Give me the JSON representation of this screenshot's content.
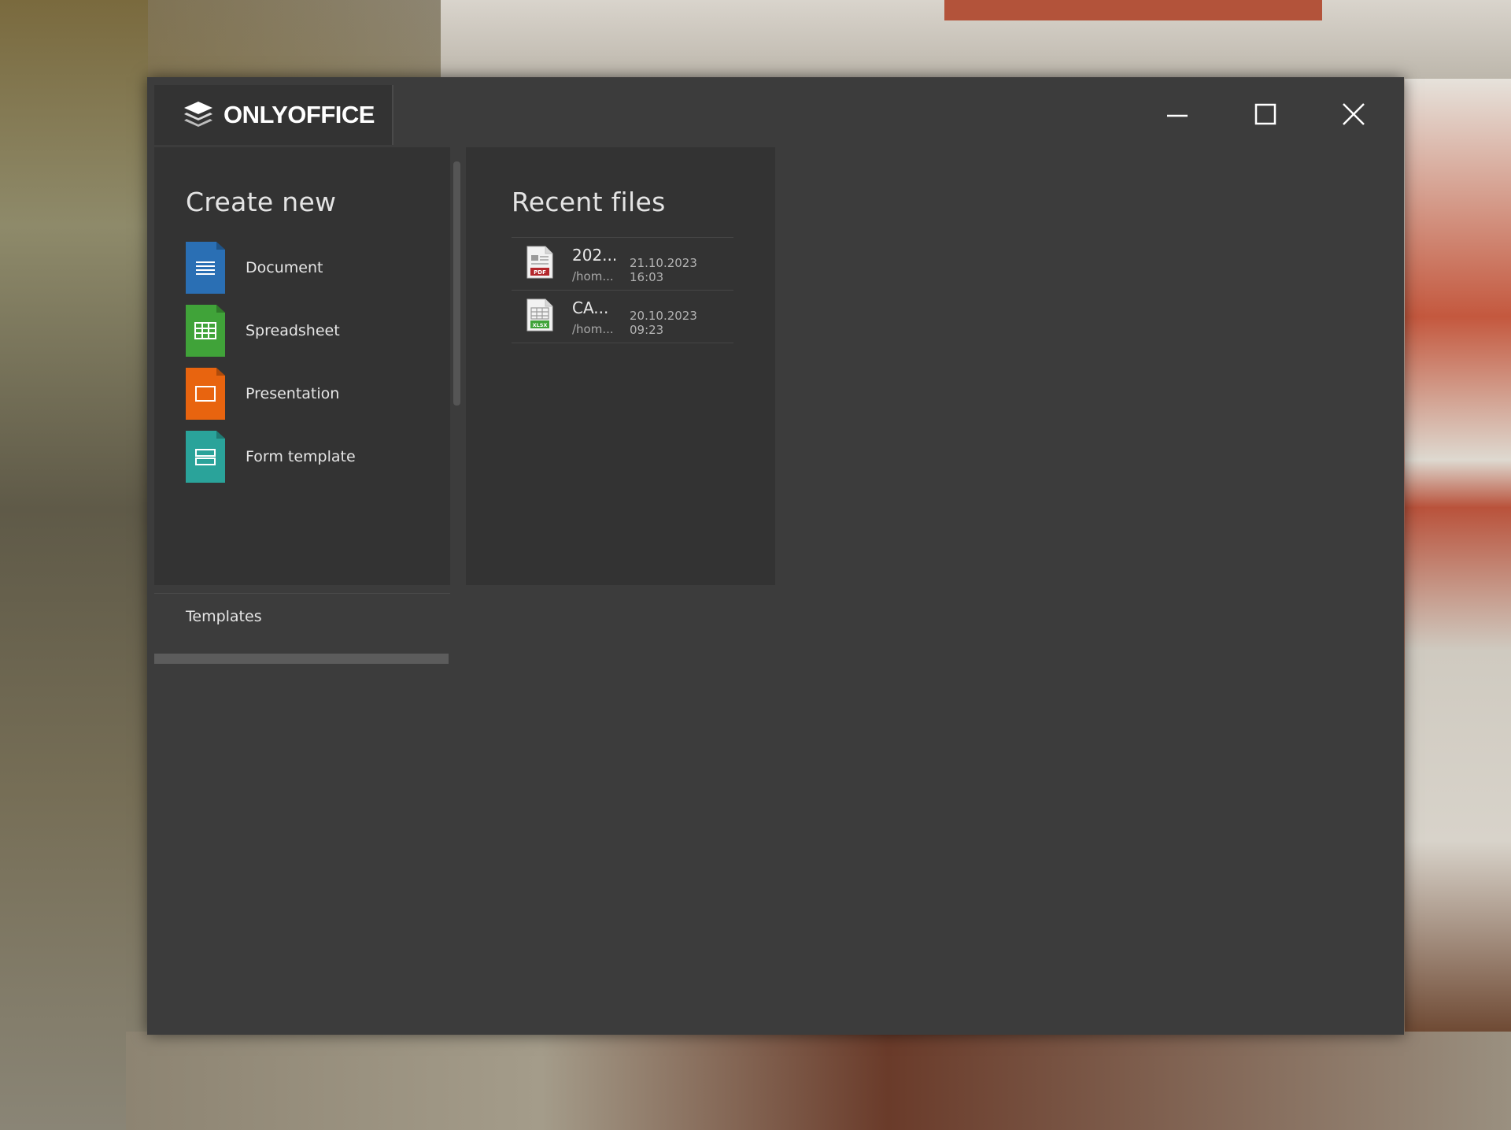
{
  "app": {
    "name": "ONLYOFFICE"
  },
  "window_controls": {
    "minimize": "minimize-icon",
    "maximize": "maximize-icon",
    "close": "close-icon"
  },
  "create_new": {
    "title": "Create new",
    "items": [
      {
        "label": "Document",
        "icon": "document-icon",
        "color": "#2a6fb4"
      },
      {
        "label": "Spreadsheet",
        "icon": "spreadsheet-icon",
        "color": "#40a339"
      },
      {
        "label": "Presentation",
        "icon": "presentation-icon",
        "color": "#e8640f"
      },
      {
        "label": "Form template",
        "icon": "form-template-icon",
        "color": "#2aa39a"
      }
    ],
    "templates_label": "Templates"
  },
  "recent_files": {
    "title": "Recent files",
    "files": [
      {
        "name": "202...",
        "path": "/hom...",
        "date": "21.10.2023 16:03",
        "type": "PDF",
        "type_color": "#b3272c"
      },
      {
        "name": "CA...",
        "path": "/hom...",
        "date": "20.10.2023 09:23",
        "type": "XLSX",
        "type_color": "#40a339"
      }
    ]
  }
}
